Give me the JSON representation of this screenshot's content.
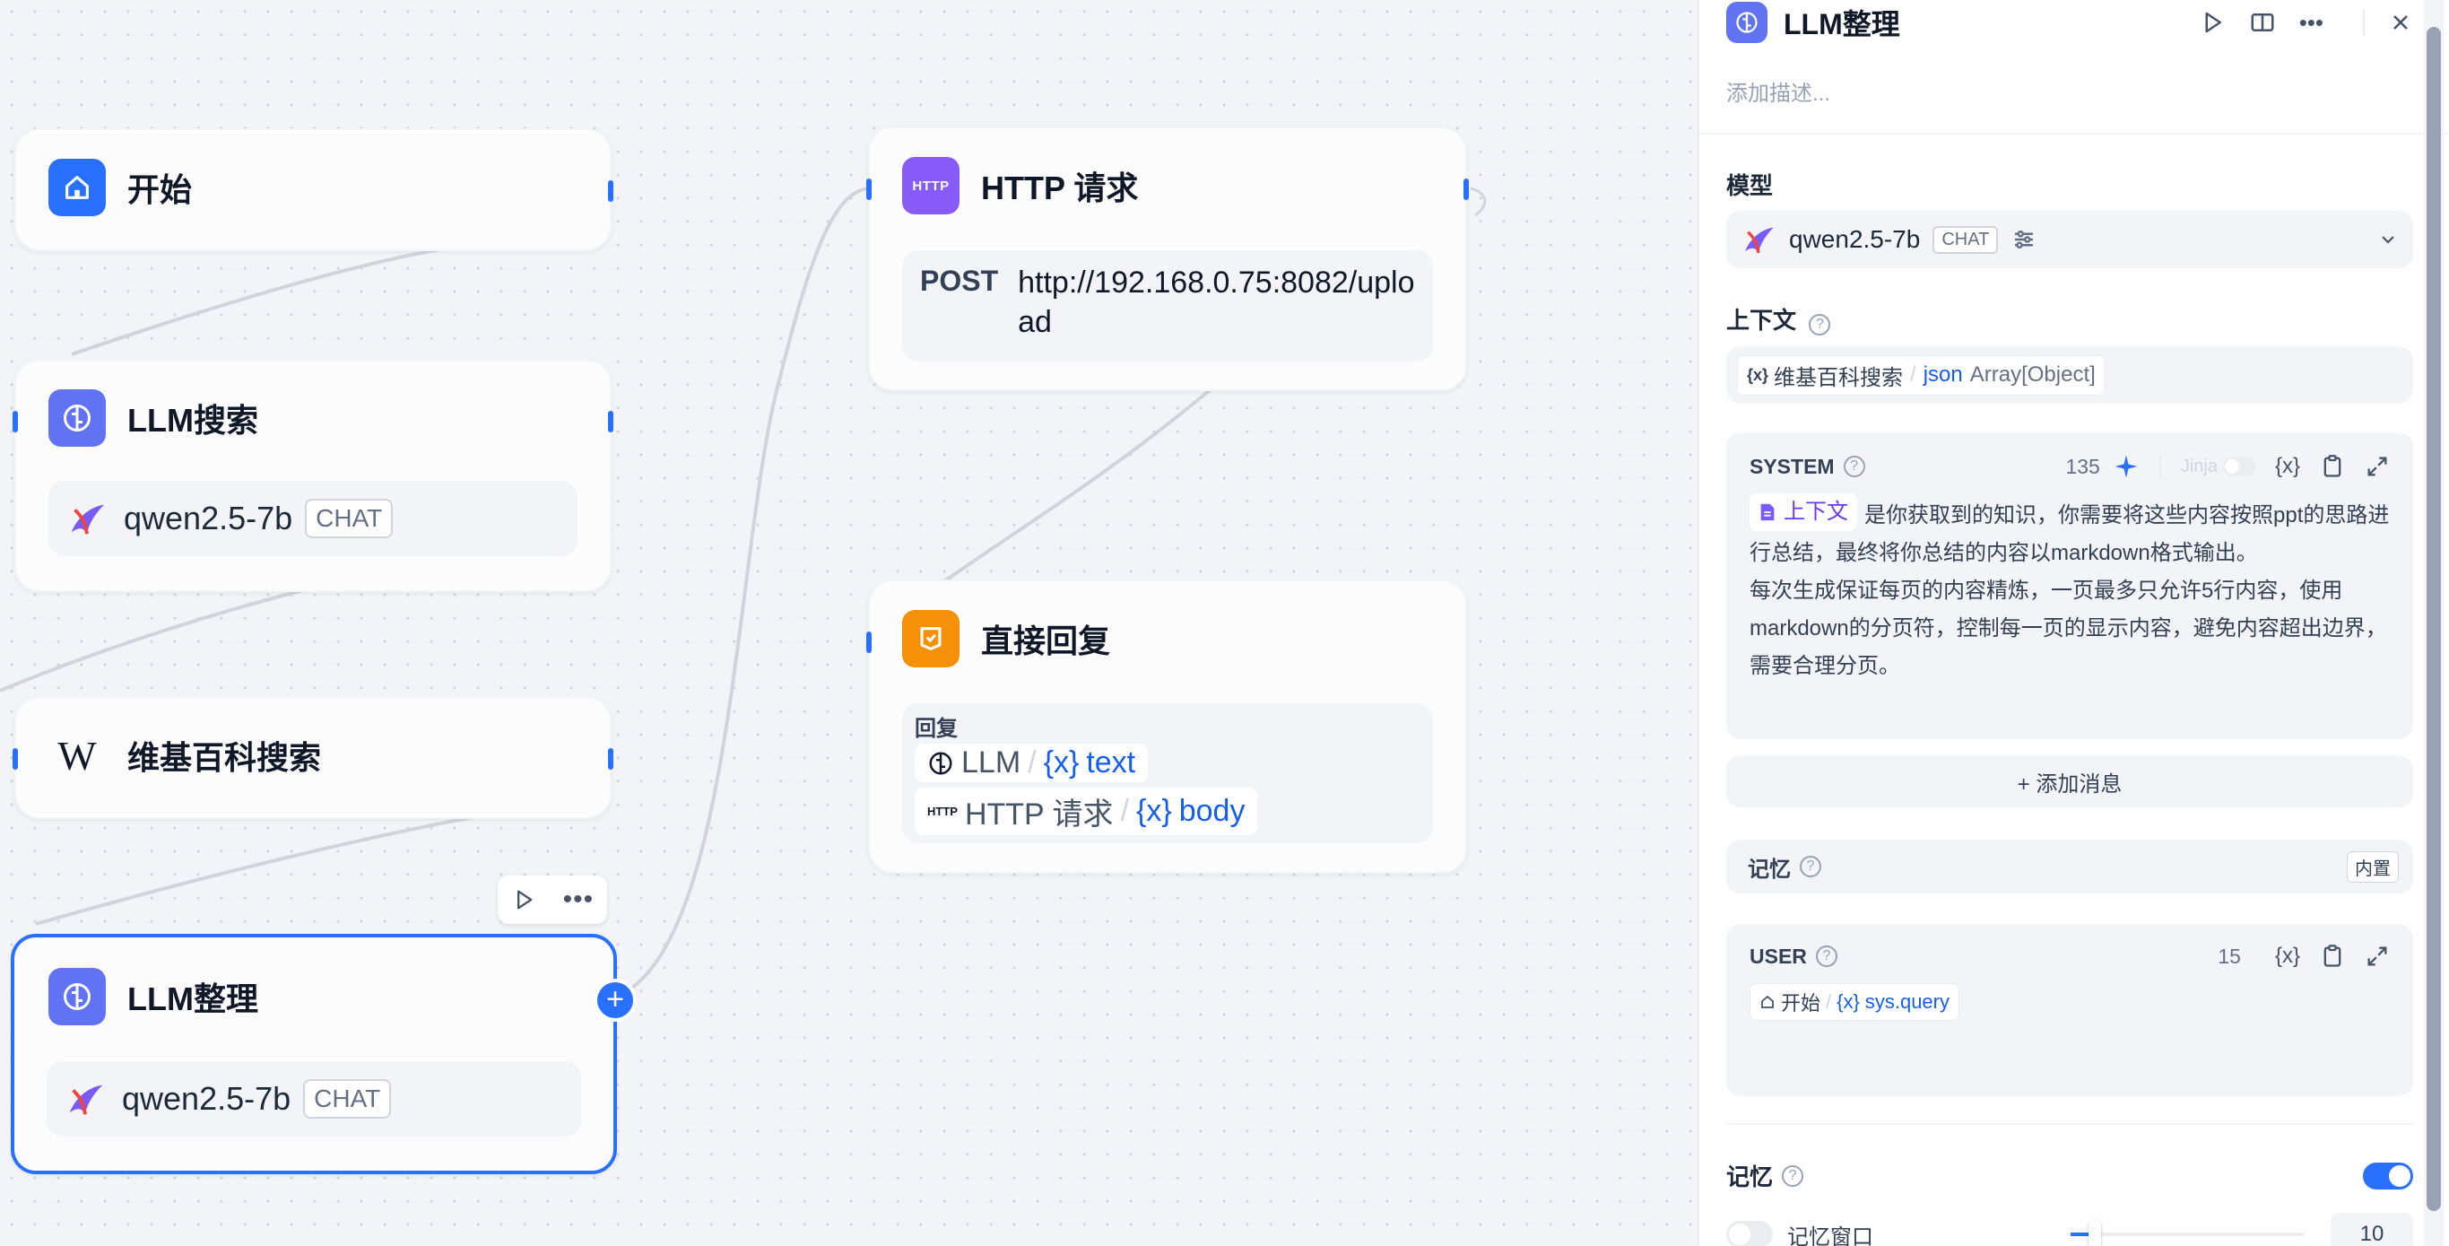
{
  "nodes": {
    "start": {
      "title": "开始"
    },
    "llm_search": {
      "title": "LLM搜索",
      "model": "qwen2.5-7b",
      "mode": "CHAT"
    },
    "wiki": {
      "title": "维基百科搜索",
      "icon_text": "W"
    },
    "llm_organize": {
      "title": "LLM整理",
      "model": "qwen2.5-7b",
      "mode": "CHAT"
    },
    "http": {
      "title": "HTTP 请求",
      "icon_text": "HTTP",
      "method": "POST",
      "url": "http://192.168.0.75:8082/upload"
    },
    "answer": {
      "title": "直接回复",
      "reply_label": "回复",
      "vars": [
        {
          "node": "LLM",
          "sep": "/",
          "var": "text"
        },
        {
          "node": "HTTP 请求",
          "sep": "/",
          "var": "body",
          "icon_text": "HTTP"
        }
      ]
    }
  },
  "panel": {
    "title": "LLM整理",
    "description_placeholder": "添加描述...",
    "model_label": "模型",
    "model": "qwen2.5-7b",
    "model_mode": "CHAT",
    "context_label": "上下文",
    "context_var": {
      "node": "维基百科搜索",
      "sep": "/",
      "var": "json",
      "type": "Array[Object]"
    },
    "system": {
      "label": "SYSTEM",
      "count": "135",
      "jinja": "Jinja",
      "context_chip": "上下文",
      "text_line1": "是你获取到的知识，你需要将这些内容按照ppt的思路进行总结，最终将你总结的内容以markdown格式输出。",
      "text_line2": "每次生成保证每页的内容精炼，一页最多只允许5行内容，使用markdown的分页符，控制每一页的显示内容，避免内容超出边界，需要合理分页。"
    },
    "add_message": "+ 添加消息",
    "memory_inline": {
      "label": "记忆",
      "badge": "内置"
    },
    "user": {
      "label": "USER",
      "count": "15",
      "var": {
        "node": "开始",
        "sep": "/",
        "var": "sys.query"
      }
    },
    "memory": {
      "label": "记忆",
      "window_label": "记忆窗口",
      "window_value": "10"
    }
  },
  "colors": {
    "accent": "#2970ff",
    "llm_icon": "#6172f3",
    "http_icon": "#875bf7",
    "answer_icon": "#f79009",
    "start_icon": "#2970ff"
  }
}
